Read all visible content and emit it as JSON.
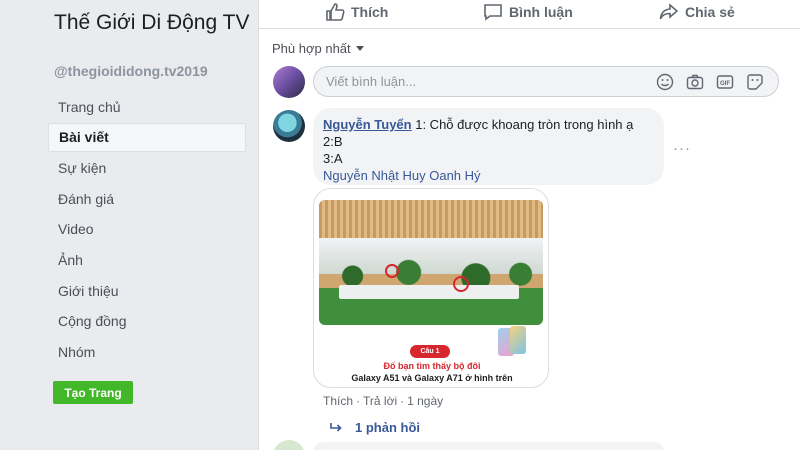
{
  "sidebar": {
    "page_name": "Thế Giới Di Động TV",
    "handle": "@thegioididong.tv2019",
    "nav": [
      {
        "label": "Trang chủ",
        "active": false
      },
      {
        "label": "Bài viết",
        "active": true
      },
      {
        "label": "Sự kiện",
        "active": false
      },
      {
        "label": "Đánh giá",
        "active": false
      },
      {
        "label": "Video",
        "active": false
      },
      {
        "label": "Ảnh",
        "active": false
      },
      {
        "label": "Giới thiệu",
        "active": false
      },
      {
        "label": "Cộng đồng",
        "active": false
      },
      {
        "label": "Nhóm",
        "active": false
      }
    ],
    "create_button": "Tạo Trang"
  },
  "post_actions": {
    "like": "Thích",
    "comment": "Bình luận",
    "share": "Chia sẻ"
  },
  "comments_section": {
    "sort_label": "Phù hợp nhất",
    "input_placeholder": "Viết bình luận...",
    "input_icons": [
      "emoji-icon",
      "camera-icon",
      "gif-icon",
      "sticker-icon"
    ]
  },
  "comment": {
    "author": "Nguyễn Tuyển",
    "line1": " 1: Chỗ được khoang tròn trong hình ạ",
    "line2": "2:B",
    "line3": "3:A",
    "tagged": "Nguyễn Nhật Huy Oanh Hý",
    "attachment": {
      "badge": "Câu 1",
      "caption_line1": "Đố bạn tìm thấy bộ đôi",
      "caption_line2": "Galaxy A51 và Galaxy A71 ở hình trên"
    },
    "meta": {
      "like": "Thích",
      "reply": "Trả lời",
      "time": "1 ngày"
    },
    "replies": "1 phản hồi"
  },
  "colors": {
    "link": "#385898",
    "create_button": "#42b72a",
    "sidebar_bg": "#e9ebee"
  }
}
